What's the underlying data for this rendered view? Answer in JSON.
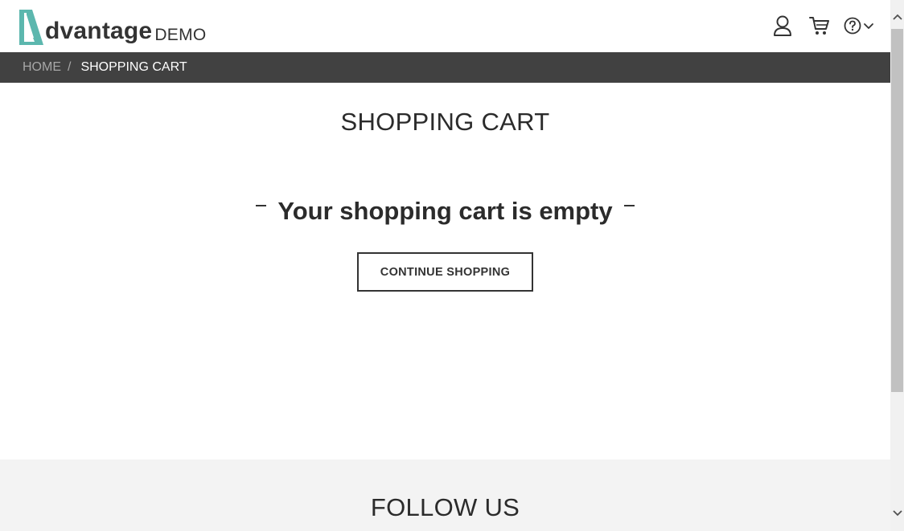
{
  "header": {
    "logo_word": "dvantage",
    "logo_demo": "DEMO",
    "icons": [
      "user-icon",
      "cart-icon",
      "help-icon",
      "chevron-down-icon"
    ]
  },
  "breadcrumb": {
    "home": "HOME",
    "separator": "/",
    "current": "SHOPPING CART"
  },
  "main": {
    "title": "SHOPPING CART",
    "empty_message": "Your shopping cart is empty",
    "continue_button": "CONTINUE SHOPPING"
  },
  "footer": {
    "follow_title": "FOLLOW US"
  },
  "colors": {
    "brand_teal": "#5cb7ae",
    "breadcrumb_bg": "#414141",
    "footer_bg": "#f3f3f3",
    "text_dark": "#2b2b2b"
  }
}
